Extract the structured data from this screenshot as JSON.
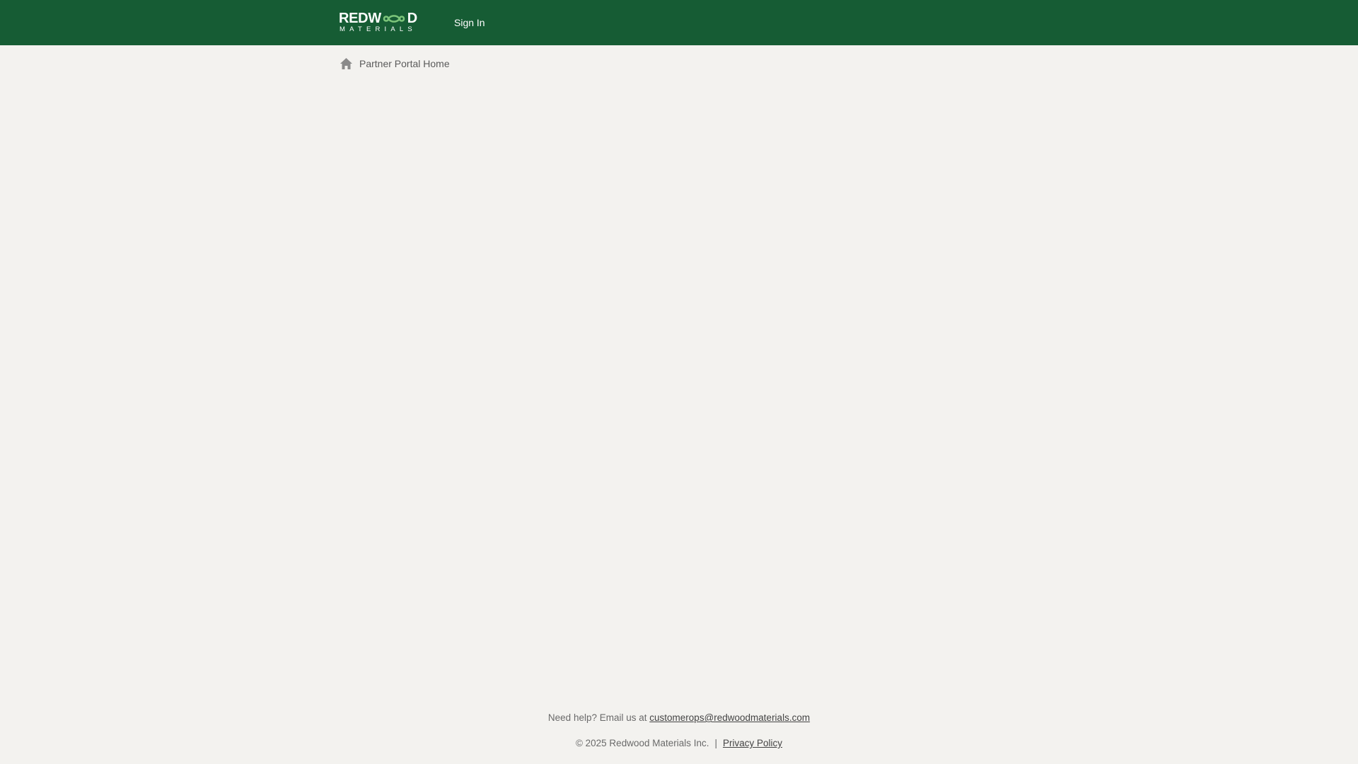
{
  "header": {
    "logo": {
      "line1": "REDWOOD",
      "line2": "MATERIALS",
      "accent_color": "#7cc57a"
    },
    "signin_label": "Sign In",
    "background_color": "#165c34"
  },
  "breadcrumb": {
    "icon": "home-icon",
    "label": "Partner Portal Home"
  },
  "footer": {
    "help_text": "Need help? Email us at",
    "help_email": "customerops@redwoodmaterials.com",
    "copyright": "© 2025 Redwood Materials Inc.",
    "separator": "|",
    "privacy_label": "Privacy Policy"
  },
  "page": {
    "background_color": "#f3f2ef"
  }
}
